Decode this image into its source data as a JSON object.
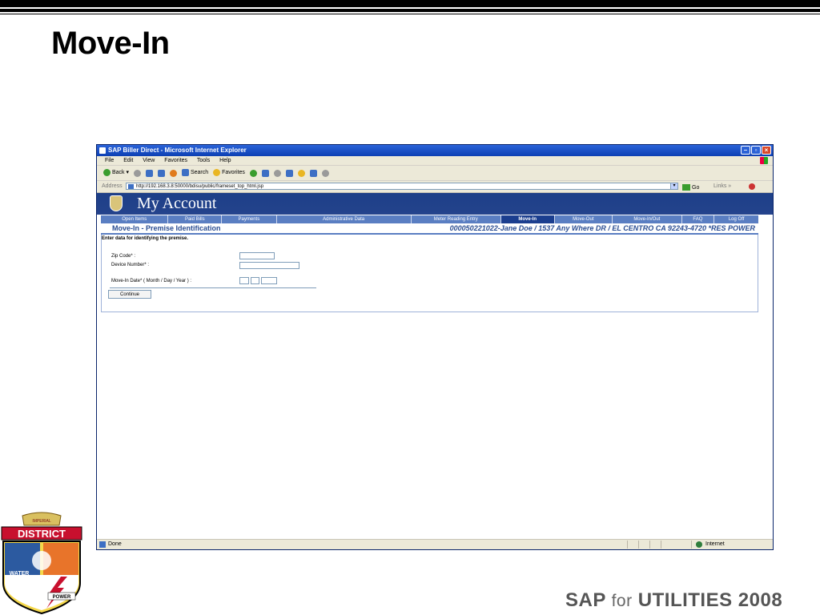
{
  "slide": {
    "title": "Move-In",
    "footer_sap": "SAP",
    "footer_for": "for",
    "footer_utilities": "UTILITIES 2008"
  },
  "browser": {
    "title": "SAP Biller Direct - Microsoft Internet Explorer",
    "menu": [
      "File",
      "Edit",
      "View",
      "Favorites",
      "Tools",
      "Help"
    ],
    "toolbar": {
      "back": "Back",
      "search": "Search",
      "favorites": "Favorites"
    },
    "address_label": "Address",
    "address_url": "http://192.168.3.8:50000/bdisu/public/frameset_top_html.jsp",
    "go_label": "Go",
    "links_label": "Links",
    "status_text": "Done",
    "zone_text": "Internet"
  },
  "app": {
    "title": "My Account",
    "nav": [
      {
        "label": "Open Items",
        "active": false
      },
      {
        "label": "Paid Bills",
        "active": false
      },
      {
        "label": "Payments",
        "active": false
      },
      {
        "label": "Administrative Data",
        "active": false
      },
      {
        "label": "Meter Reading Entry",
        "active": false
      },
      {
        "label": "Move-In",
        "active": true
      },
      {
        "label": "Move-Out",
        "active": false
      },
      {
        "label": "Move-In/Out",
        "active": false
      },
      {
        "label": "FAQ",
        "active": false
      },
      {
        "label": "Log Off",
        "active": false
      }
    ],
    "section_title": "Move-In - Premise Identification",
    "account_context": "000050221022-Jane Doe / 1537 Any Where DR / EL CENTRO CA 92243-4720 *RES POWER",
    "form": {
      "intro": "Enter data for identifying the premise.",
      "zip_label": "Zip Code* :",
      "device_label": "Device Number* :",
      "date_label": "Move-In Date* ( Month / Day / Year ) :",
      "continue_label": "Continue"
    }
  },
  "logo": {
    "top": "DISTRICT",
    "water": "WATER",
    "power": "POWER",
    "banner": "IMPERIAL"
  }
}
